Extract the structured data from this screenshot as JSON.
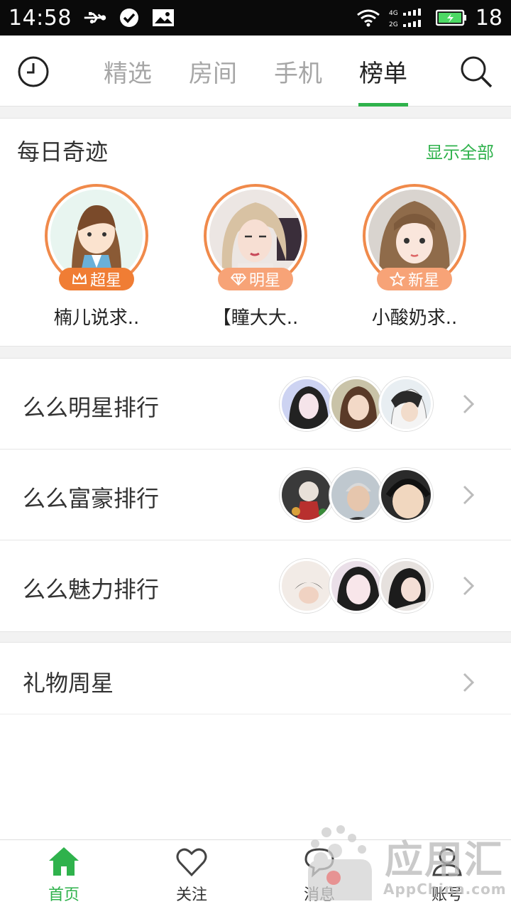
{
  "status_bar": {
    "time": "14:58",
    "battery_level": "18",
    "network": "4G 2G"
  },
  "top_nav": {
    "tabs": [
      {
        "label": "精选",
        "active": false
      },
      {
        "label": "房间",
        "active": false
      },
      {
        "label": "手机",
        "active": false
      },
      {
        "label": "榜单",
        "active": true
      }
    ]
  },
  "daily": {
    "title": "每日奇迹",
    "show_all": "显示全部",
    "stars": [
      {
        "badge": "超星",
        "badge_icon": "crown-icon",
        "name": "楠儿说求.."
      },
      {
        "badge": "明星",
        "badge_icon": "diamond-icon",
        "name": "【瞳大大.."
      },
      {
        "badge": "新星",
        "badge_icon": "star-outline-icon",
        "name": "小酸奶求.."
      }
    ]
  },
  "ranks": [
    {
      "label": "么么明星排行"
    },
    {
      "label": "么么富豪排行"
    },
    {
      "label": "么么魅力排行"
    }
  ],
  "gift": {
    "label": "礼物周星"
  },
  "bottom_bar": {
    "items": [
      {
        "label": "首页",
        "icon": "home-icon",
        "active": true
      },
      {
        "label": "关注",
        "icon": "heart-icon",
        "active": false
      },
      {
        "label": "消息",
        "icon": "message-icon",
        "active": false
      },
      {
        "label": "账号",
        "icon": "account-icon",
        "active": false
      }
    ]
  },
  "watermark": {
    "title": "应用汇",
    "subtitle": "AppChina.com"
  },
  "colors": {
    "accent": "#2fb24c",
    "badge_orange": "#f07d34",
    "ring_orange": "#f08a4b"
  }
}
